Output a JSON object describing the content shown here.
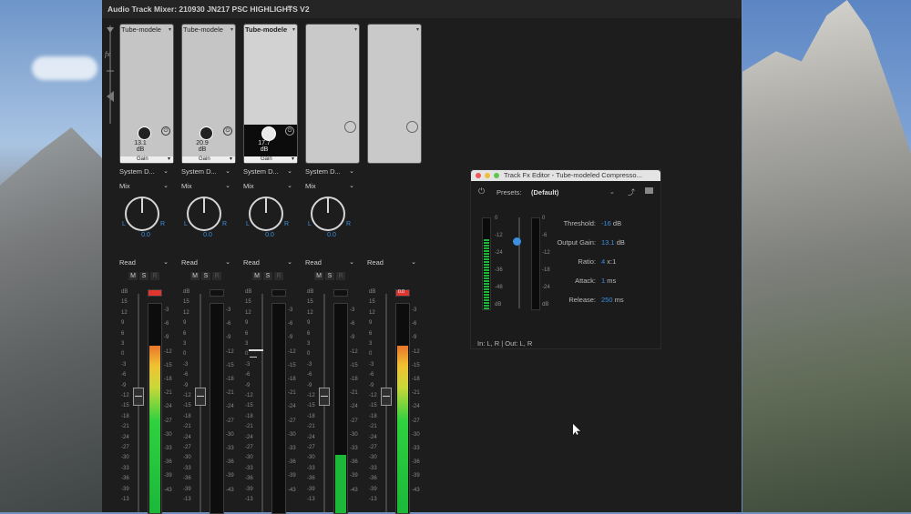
{
  "window": {
    "title": "Audio Track Mixer: 210930 JN217 PSC HIGHLIGHTS V2",
    "menu_icon": "hamburger-menu-icon"
  },
  "automation_icons": [
    "playhead-icon",
    "fx-icon",
    "sends-icon"
  ],
  "tracks": [
    {
      "fx_name": "Tube-modele",
      "gain_value": "13.1",
      "gain_unit": "dB",
      "gain_label": "Gain",
      "output": "System D...",
      "mode": "Mix",
      "pan_left": "L",
      "pan_right": "R",
      "pan_value": "0.0",
      "automation": "Read",
      "m": "M",
      "s": "S",
      "r": "R",
      "meter_level": 0.8
    },
    {
      "fx_name": "Tube-modele",
      "gain_value": "20.9",
      "gain_unit": "dB",
      "gain_label": "Gain",
      "output": "System D...",
      "mode": "Mix",
      "pan_left": "L",
      "pan_right": "R",
      "pan_value": "0.0",
      "automation": "Read",
      "m": "M",
      "s": "S",
      "r": "R",
      "meter_level": 0
    },
    {
      "fx_name": "Tube-modele",
      "gain_value": "17.7",
      "gain_unit": "dB",
      "gain_label": "Gain",
      "output": "System D...",
      "mode": "Mix",
      "pan_left": "L",
      "pan_right": "R",
      "pan_value": "0.0",
      "automation": "Read",
      "m": "M",
      "s": "S",
      "r": "R",
      "meter_level": 0
    },
    {
      "output": "System D...",
      "mode": "Mix",
      "pan_left": "L",
      "pan_right": "R",
      "pan_value": "0.0",
      "automation": "Read",
      "m": "M",
      "s": "S",
      "r": "R",
      "meter_level": 0.28
    },
    {
      "automation": "Read",
      "meter_level": 0.8
    }
  ],
  "meter_scale_left": [
    "dB",
    "15",
    "12",
    "9",
    "6",
    "3",
    "0",
    "-3",
    "-6",
    "-9",
    "-12",
    "-15",
    "-18",
    "-21",
    "-24",
    "-27",
    "-30",
    "-33",
    "-36",
    "-39",
    "-13"
  ],
  "meter_scale_right": [
    "-3",
    "-6",
    "-9",
    "-12",
    "-15",
    "-18",
    "-21",
    "-24",
    "-27",
    "-30",
    "-33",
    "-36",
    "-39",
    "-43"
  ],
  "master_clip_label": "0.0",
  "fx_editor": {
    "title": "Track Fx Editor - Tube-modeled Compresso...",
    "presets_label": "Presets:",
    "preset_value": "(Default)",
    "meter_in_scale": [
      "0",
      "-12",
      "-24",
      "-36",
      "-48",
      "dB"
    ],
    "meter_out_scale": [
      "0",
      "-6",
      "-12",
      "-18",
      "-24",
      "dB"
    ],
    "params": [
      {
        "label": "Threshold:",
        "value": "-16",
        "unit": "dB"
      },
      {
        "label": "Output Gain:",
        "value": "13.1",
        "unit": "dB"
      },
      {
        "label": "Ratio:",
        "value": "4",
        "unit": "x:1"
      },
      {
        "label": "Attack:",
        "value": "1",
        "unit": "ms"
      },
      {
        "label": "Release:",
        "value": "250",
        "unit": "ms"
      }
    ],
    "io": "In: L, R | Out: L, R"
  }
}
